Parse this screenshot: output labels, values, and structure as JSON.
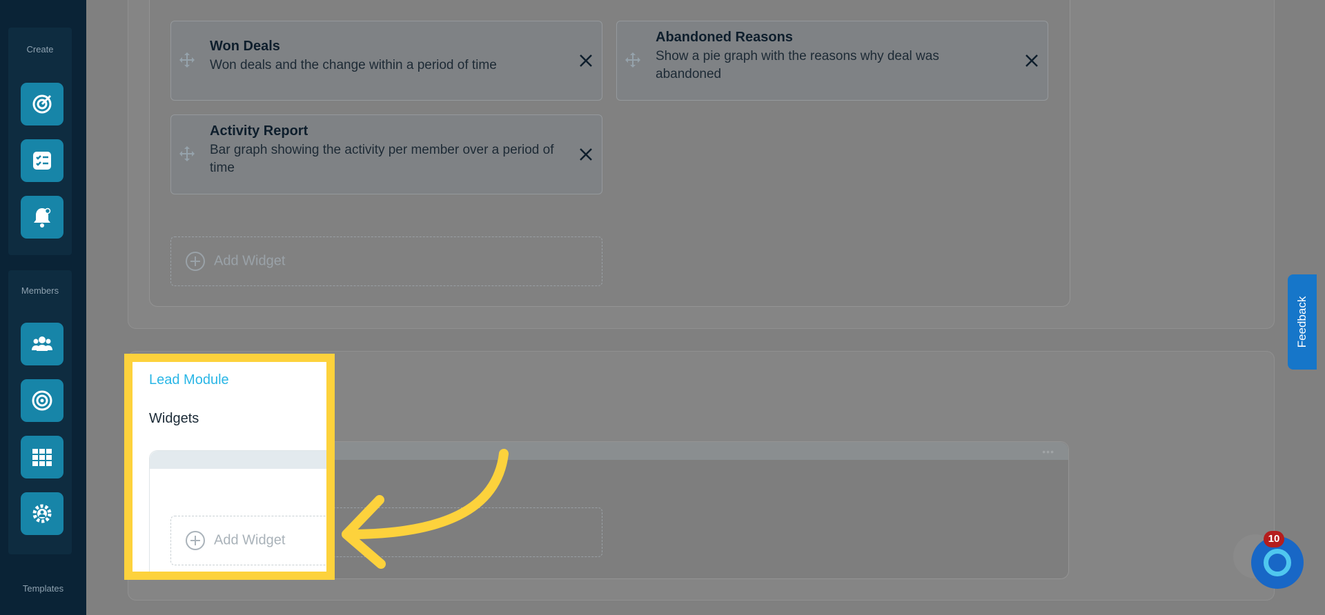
{
  "sidebar": {
    "create_label": "Create",
    "members_label": "Members",
    "templates_label": "Templates",
    "create_items": [
      {
        "icon": "target-icon"
      },
      {
        "icon": "checklist-icon"
      },
      {
        "icon": "bell-icon"
      }
    ],
    "member_items": [
      {
        "icon": "users-icon"
      },
      {
        "icon": "goal-icon"
      },
      {
        "icon": "grid-icon"
      },
      {
        "icon": "team-gear-icon"
      }
    ]
  },
  "widgets_top": [
    {
      "title": "Won Deals",
      "description": "Won deals and the change within a period of time"
    },
    {
      "title": "Abandoned Reasons",
      "description": "Show a pie graph with the reasons why deal was abandoned"
    },
    {
      "title": "Activity Report",
      "description": "Bar graph showing the activity per member over a period of time"
    }
  ],
  "add_widget_label": "Add Widget",
  "lead_module": {
    "title": "Lead Module",
    "widgets_heading": "Widgets",
    "add_widget_label": "Add Widget"
  },
  "feedback_label": "Feedback",
  "notification_count": "10",
  "colors": {
    "accent": "#29b6e6",
    "highlight": "#fdd23c",
    "sidebar": "#0a2336",
    "button": "#1785a8"
  }
}
